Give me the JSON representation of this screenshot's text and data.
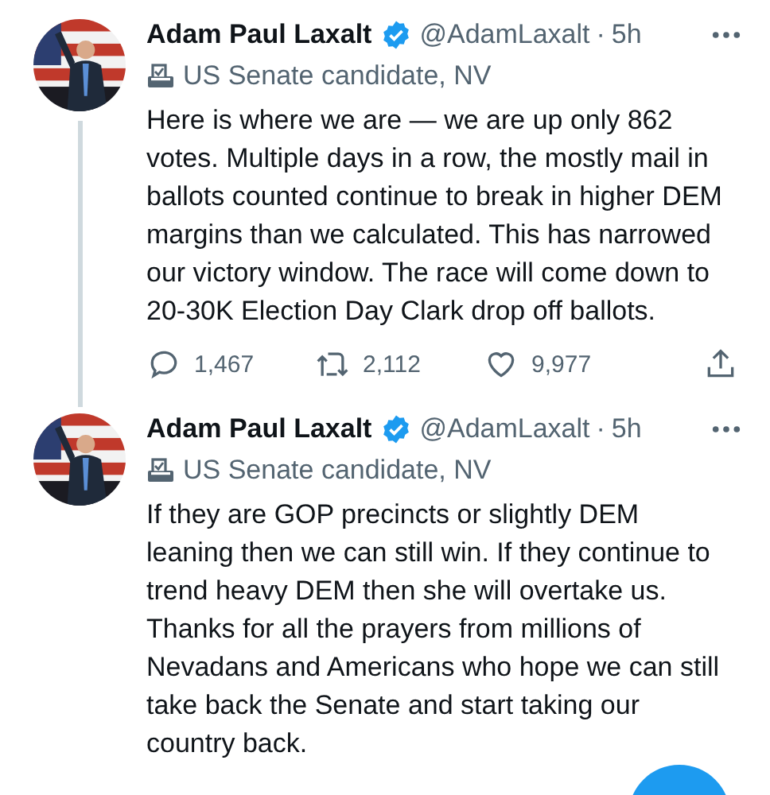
{
  "tweets": [
    {
      "name": "Adam Paul Laxalt",
      "verified": true,
      "handle": "@AdamLaxalt",
      "separator": "·",
      "time": "5h",
      "label": "US Senate candidate, NV",
      "text": "Here is where we are — we are up only 862 votes. Multiple days in a row, the mostly mail in ballots counted continue to break in higher DEM margins than we calculated. This has narrowed our victory window. The race will come down to 20-30K Election Day Clark drop off ballots.",
      "thread_line": true,
      "replies": "1,467",
      "retweets": "2,112",
      "likes": "9,977"
    },
    {
      "name": "Adam Paul Laxalt",
      "verified": true,
      "handle": "@AdamLaxalt",
      "separator": "·",
      "time": "5h",
      "label": "US Senate candidate, NV",
      "text": "If they are GOP precincts or slightly DEM leaning then we can still win. If they continue to trend heavy DEM then she will overtake us. Thanks for all the prayers from millions of Nevadans and Americans who hope we can still take back the Senate and start taking our country back.",
      "thread_line": false
    }
  ]
}
